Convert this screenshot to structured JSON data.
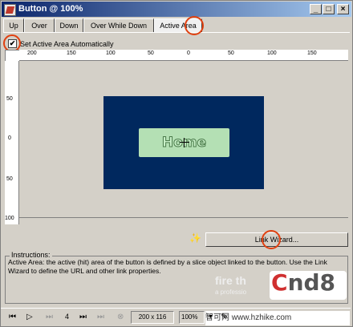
{
  "window": {
    "title": "Button @ 100%",
    "minimize": "_",
    "maximize": "□",
    "close": "×"
  },
  "tabs": [
    "Up",
    "Over",
    "Down",
    "Over While Down",
    "Active Area"
  ],
  "active_tab": "Active Area",
  "checkbox": {
    "label": "Set Active Area Automatically",
    "checked": true,
    "mark": "✔"
  },
  "ruler_h": [
    "200",
    "150",
    "100",
    "50",
    "0",
    "50",
    "100",
    "150"
  ],
  "ruler_v": [
    "50",
    "0",
    "50",
    "100"
  ],
  "canvas": {
    "button_text": "Home",
    "button_bg_color": "#00285e",
    "button_face_color": "#b4e0b4"
  },
  "link_wizard": {
    "label": "Link Wizard...",
    "icon": "magic-wand-icon"
  },
  "instructions": {
    "title": "Instructions:",
    "text": "Active Area: the active (hit) area of the button is defined by a slice object linked to the button. Use the Link Wizard to define the URL and other link properties."
  },
  "watermark": {
    "fire": "fire th",
    "sub": "a professio",
    "logo_a": "C",
    "logo_b": "nd8",
    "url": "智可网 www.hzhike.com"
  },
  "statusbar": {
    "frame": "4",
    "size": "200 x 116",
    "zoom": "100%",
    "zoom_arrow": "▼"
  },
  "colors": {
    "annotation_circle": "#e04010",
    "titlebar": "#0a246a"
  }
}
